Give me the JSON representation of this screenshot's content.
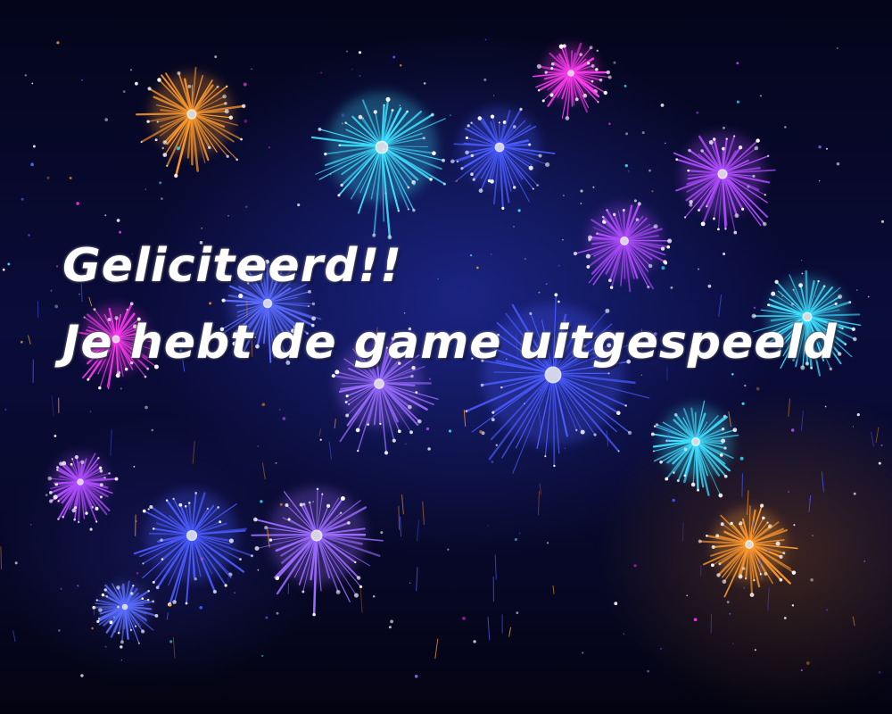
{
  "message": {
    "line1": "Geliciteerd!!",
    "line2": "Je hebt de game uitgespeeld"
  },
  "scene": {
    "background": "night sky with fireworks",
    "firework_colors": [
      "#ff9a2e",
      "#3fe0ff",
      "#ff3cf0",
      "#4a5bff",
      "#b04dff",
      "#5a6cff",
      "#9b6bff"
    ]
  }
}
